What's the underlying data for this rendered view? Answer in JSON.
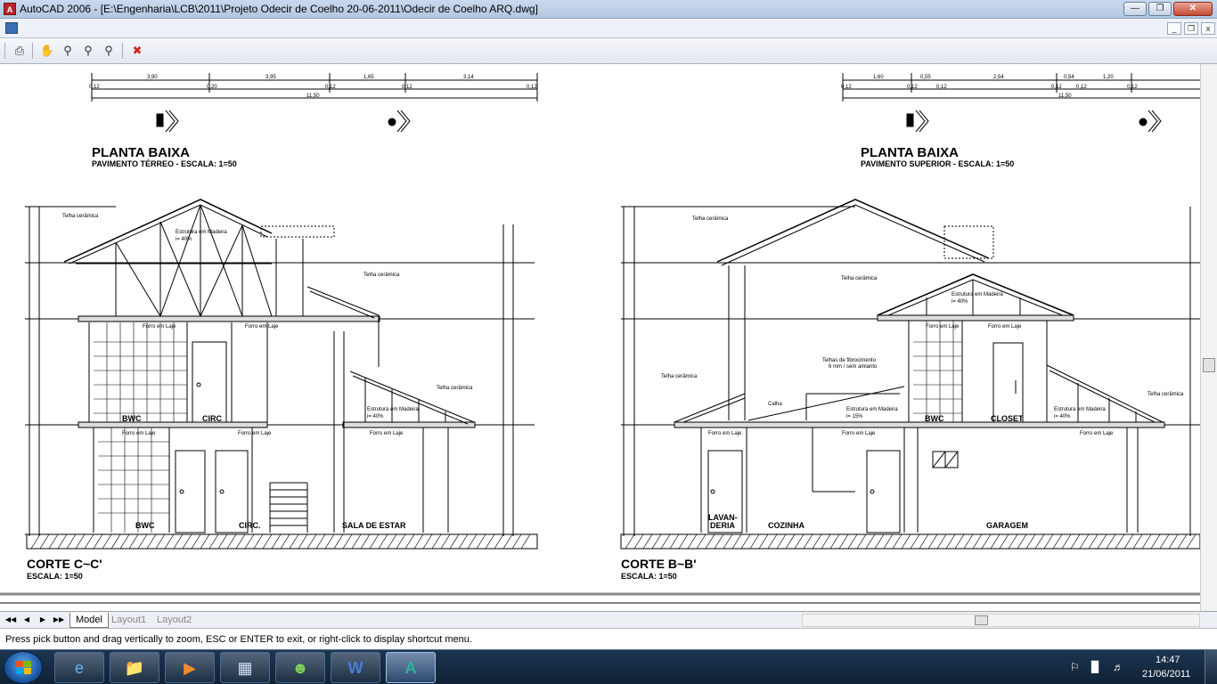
{
  "window": {
    "title": "AutoCAD 2006 - [E:\\Engenharia\\LCB\\2011\\Projeto Odecir  de Coelho 20-06-2011\\Odecir de Coelho ARQ.dwg]",
    "app_icon": "autocad-icon"
  },
  "toolbar": {
    "icons": [
      "plot-icon",
      "pan-icon",
      "zoom-realtime-icon",
      "zoom-window-icon",
      "zoom-previous-icon",
      "close-zoom-icon"
    ]
  },
  "drawing": {
    "left_plan": {
      "title": "PLANTA BAIXA",
      "subtitle": "PAVIMENTO TÉRREO - ESCALA: 1=50",
      "dims_top": [
        "3,90",
        "3,95",
        "1,65",
        "3,14"
      ],
      "dims_bottom": [
        "0,12",
        "0,20",
        "0,12",
        "0,12",
        "0,12"
      ],
      "total": "11,50"
    },
    "right_plan": {
      "title": "PLANTA BAIXA",
      "subtitle": "PAVIMENTO SUPERIOR - ESCALA: 1=50",
      "dims_top": [
        "1,60",
        "0,55",
        "2,54",
        "0,54",
        "1,20"
      ],
      "dims_bottom": [
        "0,12",
        "0,12",
        "0,12",
        "0,12",
        "0,12",
        "0,12"
      ],
      "total": "11,50"
    },
    "left_section": {
      "title": "CORTE C~C'",
      "subtitle": "ESCALA: 1=50",
      "annotations": {
        "roof_tile_1": "Telha cerâmica",
        "wood_structure": "Estrutura em Madeira",
        "slope_40": "i= 40%",
        "roof_tile_2": "Telha cerâmica",
        "ceiling_1": "Forro em Laje",
        "ceiling_2": "Forro em Laje",
        "roof_tile_3": "Telha cerâmica",
        "wood_structure_2": "Estrutura em Madeira",
        "slope_40b": "i= 40%",
        "ceiling_3": "Forro em Laje",
        "ceiling_4": "Forro em Laje",
        "ceiling_5": "Forro em Laje"
      },
      "rooms": [
        "BWC",
        "CIRC",
        "BWC",
        "CIRC.",
        "SALA DE ESTAR"
      ]
    },
    "right_section": {
      "title": "CORTE B~B'",
      "subtitle": "ESCALA: 1=50",
      "annotations": {
        "roof_tile_1": "Telha cerâmica",
        "roof_tile_2": "Telha cerâmica",
        "wood_structure": "Estrutura em Madeira",
        "slope_40": "i= 40%",
        "fiber_tiles": "Telhas de fibrocimento",
        "fiber_tiles_2": "6 mm / sem amianto",
        "roof_tile_3": "Telha cerâmica",
        "gutter": "Calha",
        "wood_structure_2": "Estrutura em Madeira",
        "slope_15": "i= 15%",
        "ceiling_1": "Forro em Laje",
        "ceiling_2": "Forro em Laje",
        "roof_tile_4": "Telha cerâmica",
        "wood_structure_3": "Estrutura em Madeira",
        "slope_40b": "i= 40%",
        "ceiling_3": "Forro em Laje",
        "ceiling_4": "Forro em Laje",
        "ceiling_5": "Forro em Laje"
      },
      "rooms": [
        "BWC",
        "CLOSET",
        "LAVAN-",
        "DERIA",
        "COZINHA",
        "GARAGEM"
      ]
    }
  },
  "tabs": {
    "model": "Model",
    "layout1": "Layout1",
    "layout2": "Layout2"
  },
  "command_line": {
    "text": "Press pick button and drag vertically to zoom, ESC or ENTER to exit, or right-click to display shortcut menu."
  },
  "taskbar": {
    "apps": [
      "ie-icon",
      "explorer-icon",
      "media-player-icon",
      "calculator-icon",
      "messenger-icon",
      "word-icon",
      "autocad-icon"
    ],
    "time": "14:47",
    "date": "21/06/2011"
  },
  "colors": {
    "title_bar": "#c9d9ee",
    "taskbar": "#1d3550",
    "close_button": "#c44a34",
    "drawing_bg": "#ffffff"
  }
}
